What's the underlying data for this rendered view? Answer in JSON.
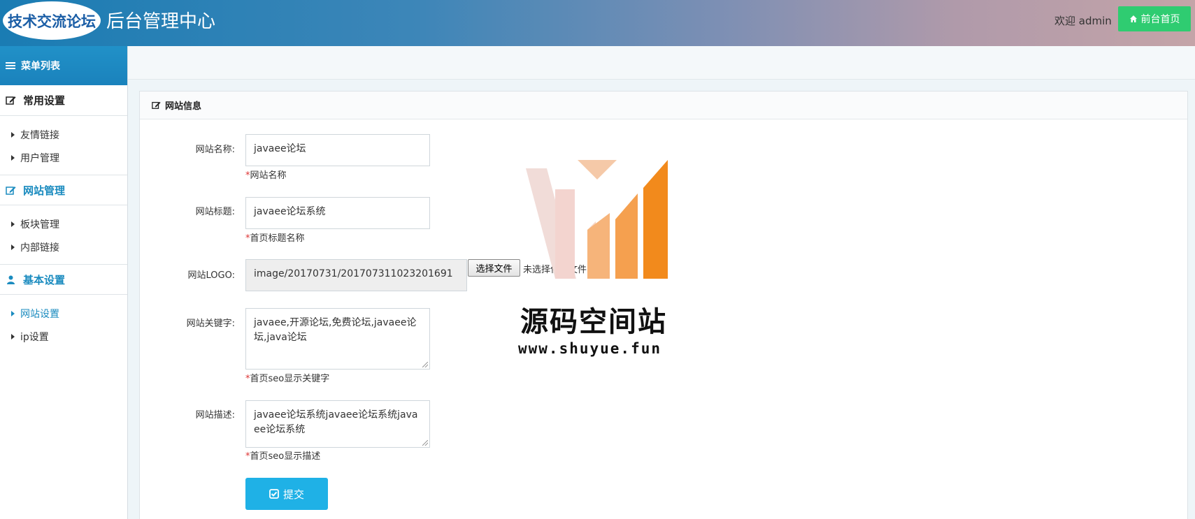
{
  "header": {
    "logo_text": "技术交流论坛",
    "title": "后台管理中心",
    "welcome": "欢迎 admin",
    "home_button": "前台首页"
  },
  "sidebar": {
    "menu_title": "菜单列表",
    "groups": [
      {
        "title": "常用设置",
        "icon": "edit-icon",
        "items": [
          "友情链接",
          "用户管理"
        ]
      },
      {
        "title": "网站管理",
        "icon": "edit-icon",
        "items": [
          "板块管理",
          "内部链接"
        ]
      },
      {
        "title": "基本设置",
        "icon": "user-icon",
        "items": [
          "网站设置",
          "ip设置"
        ]
      }
    ],
    "active_group": "网站管理",
    "active_item": "网站设置"
  },
  "panel": {
    "title": "网站信息"
  },
  "form": {
    "site_name": {
      "label": "网站名称:",
      "value": "javaee论坛",
      "hint": "网站名称"
    },
    "site_title": {
      "label": "网站标题:",
      "value": "javaee论坛系统",
      "hint": "首页标题名称"
    },
    "site_logo": {
      "label": "网站LOGO:",
      "value": "image/20170731/201707311023201691",
      "file_button": "选择文件",
      "file_status": "未选择任何文件"
    },
    "site_keywords": {
      "label": "网站关键字:",
      "value": "javaee,开源论坛,免费论坛,javaee论坛,java论坛",
      "hint": "首页seo显示关键字"
    },
    "site_description": {
      "label": "网站描述:",
      "value": "javaee论坛系统javaee论坛系统javaee论坛系统",
      "hint": "首页seo显示描述"
    },
    "submit": "提交",
    "required_mark": "*"
  },
  "watermark": {
    "title": "源码空间站",
    "url": "www.shuyue.fun"
  },
  "colors": {
    "accent": "#1a8bbf",
    "submit": "#1fb1e6",
    "home_button": "#2fcc71",
    "required": "#dd3333"
  }
}
